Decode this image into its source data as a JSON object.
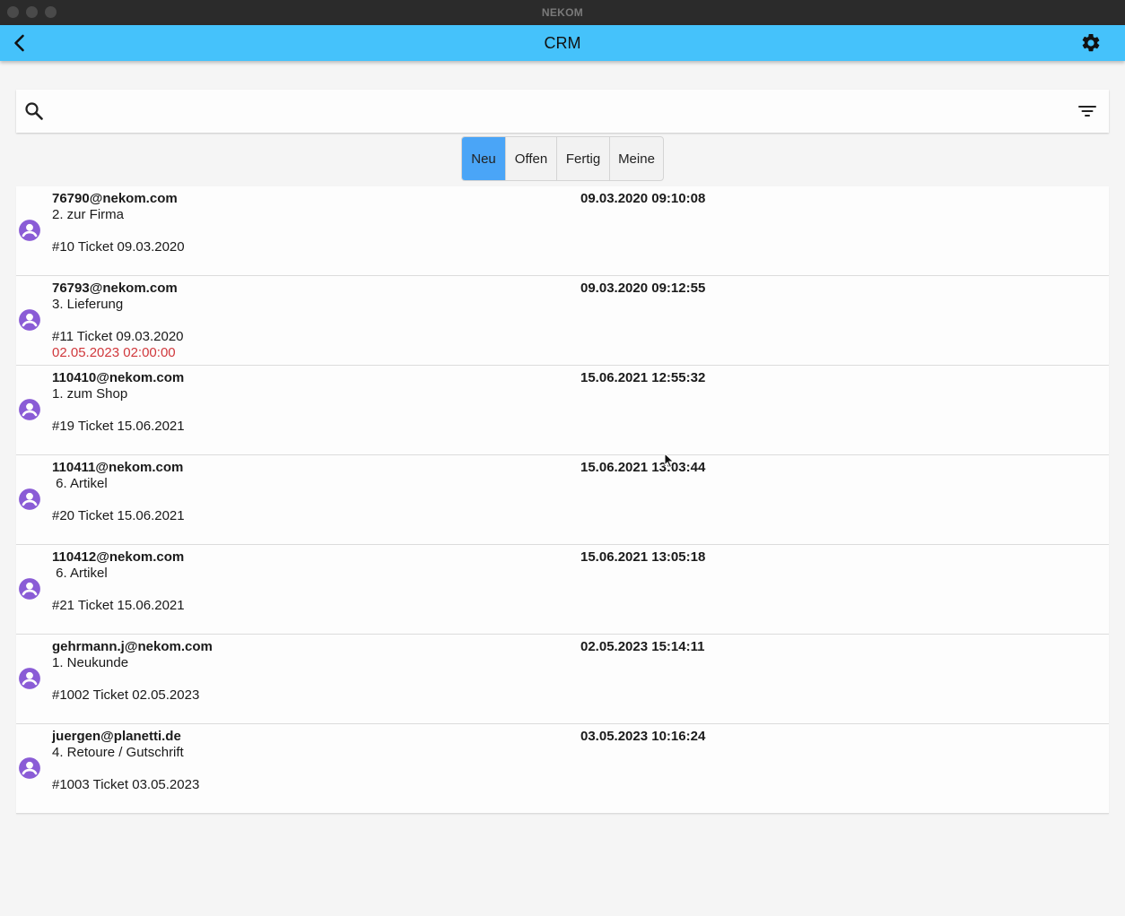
{
  "window": {
    "title": "NEKOM"
  },
  "appbar": {
    "title": "CRM",
    "back_icon": "back-arrow-icon",
    "settings_icon": "gear-icon",
    "color": "#45c2fb"
  },
  "search": {
    "value": "",
    "placeholder": "",
    "search_icon": "search-icon",
    "filter_icon": "filter-icon"
  },
  "tabs": [
    {
      "label": "Neu",
      "active": true
    },
    {
      "label": "Offen",
      "active": false
    },
    {
      "label": "Fertig",
      "active": false
    },
    {
      "label": "Meine",
      "active": false
    }
  ],
  "colors": {
    "accent_tab": "#4aa5f7",
    "avatar": "#8a5cd6",
    "overdue": "#d0383c"
  },
  "tickets": [
    {
      "email": "76790@nekom.com",
      "category": "2. zur Firma",
      "ticket": "#10 Ticket 09.03.2020",
      "due": "",
      "date": "09.03.2020 09:10:08"
    },
    {
      "email": "76793@nekom.com",
      "category": "3. Lieferung",
      "ticket": "#11 Ticket 09.03.2020",
      "due": "02.05.2023 02:00:00",
      "date": "09.03.2020 09:12:55"
    },
    {
      "email": "110410@nekom.com",
      "category": "1. zum Shop",
      "ticket": "#19 Ticket 15.06.2021",
      "due": "",
      "date": "15.06.2021 12:55:32"
    },
    {
      "email": "110411@nekom.com",
      "category": " 6. Artikel",
      "ticket": "#20 Ticket 15.06.2021",
      "due": "",
      "date": "15.06.2021 13:03:44"
    },
    {
      "email": "110412@nekom.com",
      "category": " 6. Artikel",
      "ticket": "#21 Ticket 15.06.2021",
      "due": "",
      "date": "15.06.2021 13:05:18"
    },
    {
      "email": "gehrmann.j@nekom.com",
      "category": "1. Neukunde",
      "ticket": "#1002 Ticket 02.05.2023",
      "due": "",
      "date": "02.05.2023 15:14:11"
    },
    {
      "email": "juergen@planetti.de",
      "category": "4. Retoure / Gutschrift",
      "ticket": "#1003 Ticket 03.05.2023",
      "due": "",
      "date": "03.05.2023 10:16:24"
    }
  ]
}
